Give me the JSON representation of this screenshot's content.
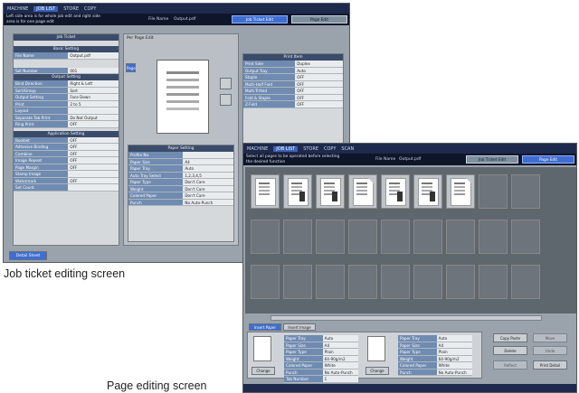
{
  "job_screen": {
    "topbar_tabs": [
      "MACHINE",
      "JOB LIST",
      "STORE",
      "COPY"
    ],
    "message": "Left side area is for whole job edit and right side area is for one page edit",
    "file_name_label": "File Name",
    "file_name_value": "Output.pdf",
    "header_buttons": [
      "Job Ticket Edit",
      "Page Edit"
    ],
    "left_title": "Job Ticket",
    "per_page_label": "Per Page Edit",
    "basic_setting_title": "Basic Setting",
    "basic_rows": [
      {
        "k": "File Name",
        "v": "Output.pdf"
      },
      {
        "k": "Set Number",
        "v": "001"
      }
    ],
    "output_title": "Output Setting",
    "output_rows": [
      {
        "k": "Bind Direction",
        "v": "Right & Left"
      },
      {
        "k": "Sort/Group",
        "v": "Sort"
      },
      {
        "k": "Output Setting",
        "v": "Face Down"
      },
      {
        "k": "Print",
        "v": "2 to 5"
      },
      {
        "k": "Layout",
        "v": ""
      },
      {
        "k": "Separate Tab Print",
        "v": "Do Not Output"
      },
      {
        "k": "Ring Print",
        "v": "OFF"
      }
    ],
    "application_title": "Application Setting",
    "application_rows": [
      {
        "k": "Booklet",
        "v": "OFF"
      },
      {
        "k": "Adhesive Binding",
        "v": "OFF"
      },
      {
        "k": "Combine",
        "v": "OFF"
      },
      {
        "k": "Image Repeat",
        "v": "OFF"
      },
      {
        "k": "Page Margin",
        "v": "OFF"
      },
      {
        "k": "Stamp Image",
        "v": ""
      },
      {
        "k": "Watermark",
        "v": "OFF"
      },
      {
        "k": "Set Count",
        "v": ""
      }
    ],
    "paper_setting_title": "Paper Setting",
    "paper_rows": [
      {
        "k": "Profile No.",
        "v": ""
      },
      {
        "k": "Paper Size",
        "v": "A4"
      },
      {
        "k": "Paper Tray",
        "v": "Auto"
      },
      {
        "k": "Auto Tray Select",
        "v": "1,2,3,4,5"
      },
      {
        "k": "Paper Type",
        "v": "Don't Care"
      },
      {
        "k": "Weight",
        "v": "Don't Care"
      },
      {
        "k": "Colored Paper",
        "v": "Don't Care"
      },
      {
        "k": "Punch",
        "v": "No Auto-Punch"
      }
    ],
    "right_title": "Print Item",
    "right_rows": [
      {
        "k": "Print Side",
        "v": "Duplex"
      },
      {
        "k": "Output Tray",
        "v": "Auto"
      },
      {
        "k": "Staple",
        "v": "OFF"
      },
      {
        "k": "Multi-Half Fold",
        "v": "OFF"
      },
      {
        "k": "Multi-Trifold",
        "v": "OFF"
      },
      {
        "k": "Fold & Staple",
        "v": "OFF"
      },
      {
        "k": "Z-Fold",
        "v": "OFF"
      }
    ],
    "side_tab": "Page",
    "bottom_button": "Detail Sheet"
  },
  "page_screen": {
    "topbar_tabs": [
      "MACHINE",
      "JOB LIST",
      "STORE",
      "COPY",
      "SCAN"
    ],
    "message": "Select all pages to be operated before selecting the desired function",
    "file_name_label": "File Name",
    "file_name_value": "Output.pdf",
    "header_buttons": [
      "Job Ticket Edit",
      "Page Edit"
    ],
    "tabs": [
      "Insert Paper",
      "Insert Image"
    ],
    "details_left": [
      {
        "k": "Paper Tray",
        "v": "Auto"
      },
      {
        "k": "Paper Size",
        "v": "A4"
      },
      {
        "k": "Paper Type",
        "v": "Plain"
      },
      {
        "k": "Weight",
        "v": "64-90g/m2"
      },
      {
        "k": "Colored Paper",
        "v": "White"
      },
      {
        "k": "Punch",
        "v": "No Auto-Punch"
      },
      {
        "k": "Tab Number",
        "v": "1"
      }
    ],
    "details_right": [
      {
        "k": "Paper Tray",
        "v": "Auto"
      },
      {
        "k": "Paper Size",
        "v": "A4"
      },
      {
        "k": "Paper Type",
        "v": "Plain"
      },
      {
        "k": "Weight",
        "v": "64-90g/m2"
      },
      {
        "k": "Colored Paper",
        "v": "White"
      },
      {
        "k": "Punch",
        "v": "No Auto-Punch"
      }
    ],
    "side_buttons": [
      "Copy Paste",
      "Move",
      "Delete",
      "Undo",
      "Reflect",
      "Print Detail"
    ],
    "change_button": "Change"
  },
  "captions": {
    "job": "Job ticket editing screen",
    "page": "Page editing screen"
  }
}
